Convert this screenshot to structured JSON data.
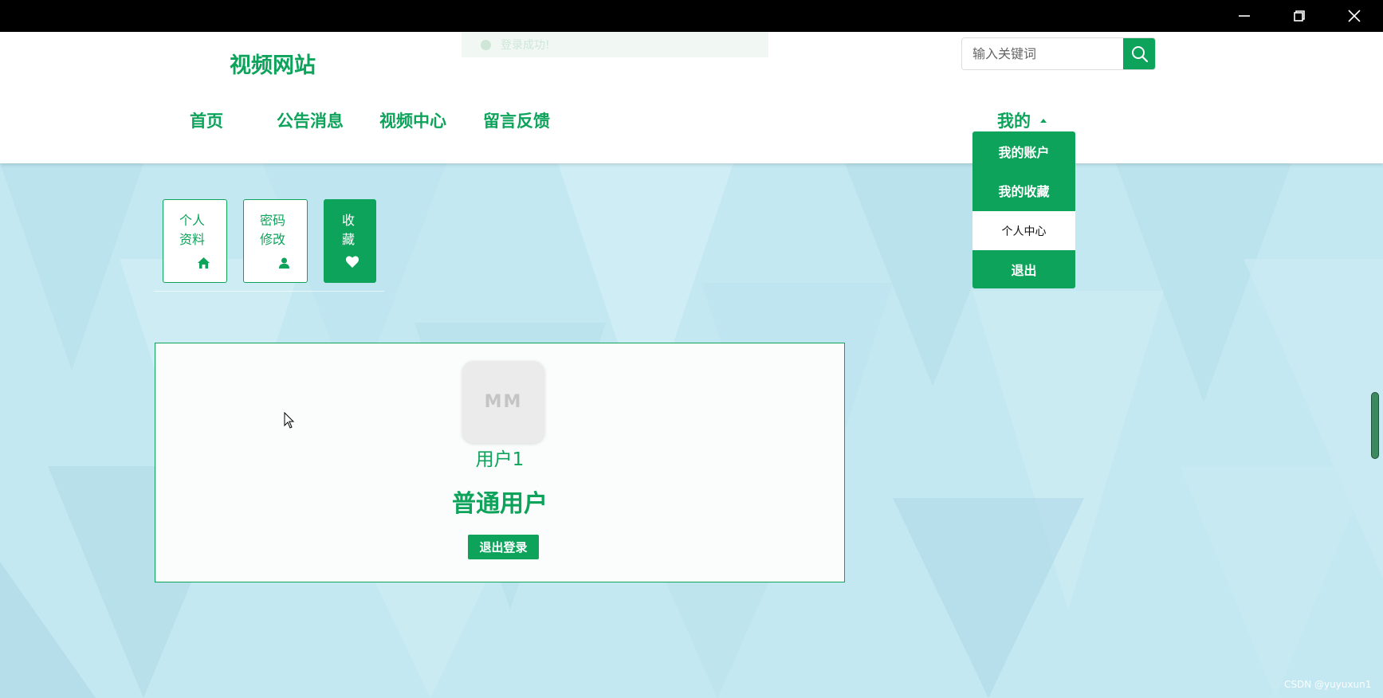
{
  "site": {
    "title": "视频网站"
  },
  "toast": {
    "message": "登录成功!"
  },
  "search": {
    "placeholder": "输入关键词"
  },
  "nav": {
    "items": [
      {
        "label": "首页"
      },
      {
        "label": "公告消息"
      },
      {
        "label": "视频中心"
      },
      {
        "label": "留言反馈"
      }
    ],
    "mine_label": "我的"
  },
  "dropdown": {
    "items": [
      {
        "label": "我的账户"
      },
      {
        "label": "我的收藏"
      },
      {
        "label": "个人中心"
      },
      {
        "label": "退出"
      }
    ]
  },
  "tabs": [
    {
      "label_line1": "个人",
      "label_line2": "资料",
      "icon": "home-icon"
    },
    {
      "label_line1": "密码",
      "label_line2": "修改",
      "icon": "user-icon"
    },
    {
      "label_line1": "收",
      "label_line2": "藏",
      "icon": "heart-icon",
      "active": true
    }
  ],
  "profile": {
    "avatar_text": "MM",
    "username": "用户1",
    "role": "普通用户",
    "logout_label": "退出登录"
  },
  "watermark": "CSDN @yuyuxun1",
  "colors": {
    "primary": "#0da35b",
    "background": "#bfe6f0"
  }
}
